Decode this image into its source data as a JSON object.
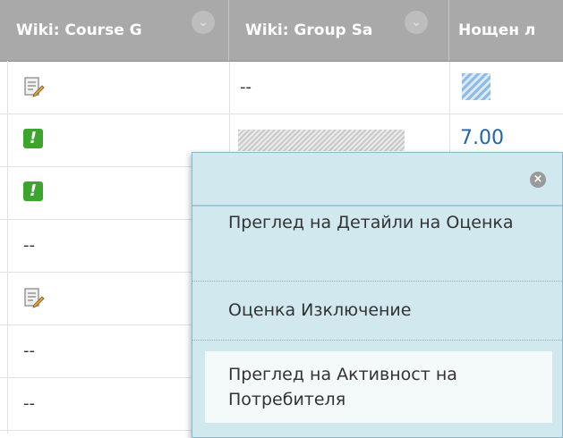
{
  "columns": [
    {
      "label": "Wiki: Course G"
    },
    {
      "label": "Wiki: Group Sa"
    },
    {
      "label": "Нощен л"
    }
  ],
  "chevron_glyph": "⌄",
  "rows": [
    {
      "c1": "edit-icon",
      "c2": "--",
      "c3": "blue-hatch"
    },
    {
      "c1": "alert-icon",
      "c2": "gray-hatch",
      "c3": "7.00"
    },
    {
      "c1": "alert-icon",
      "c2": "",
      "c3": ""
    },
    {
      "c1": "--",
      "c2": "",
      "c3": ""
    },
    {
      "c1": "edit-icon",
      "c2": "",
      "c3": ""
    },
    {
      "c1": "--",
      "c2": "",
      "c3": ""
    },
    {
      "c1": "--",
      "c2": "",
      "c3": ""
    }
  ],
  "text": {
    "dash": "--",
    "score": "7.00",
    "alert_glyph": "!",
    "close_glyph": "×"
  },
  "context_menu": {
    "search_value": "",
    "items": [
      {
        "label": "Преглед на Детайли на Оценка"
      },
      {
        "label": "Оценка Изключение"
      },
      {
        "label": "Преглед на Активност на Потребителя"
      }
    ]
  },
  "colors": {
    "header_bg": "#a9a9a9",
    "menu_bg": "#d1e8ee",
    "alert_green": "#3ca52e",
    "link_blue": "#1f63b5"
  }
}
